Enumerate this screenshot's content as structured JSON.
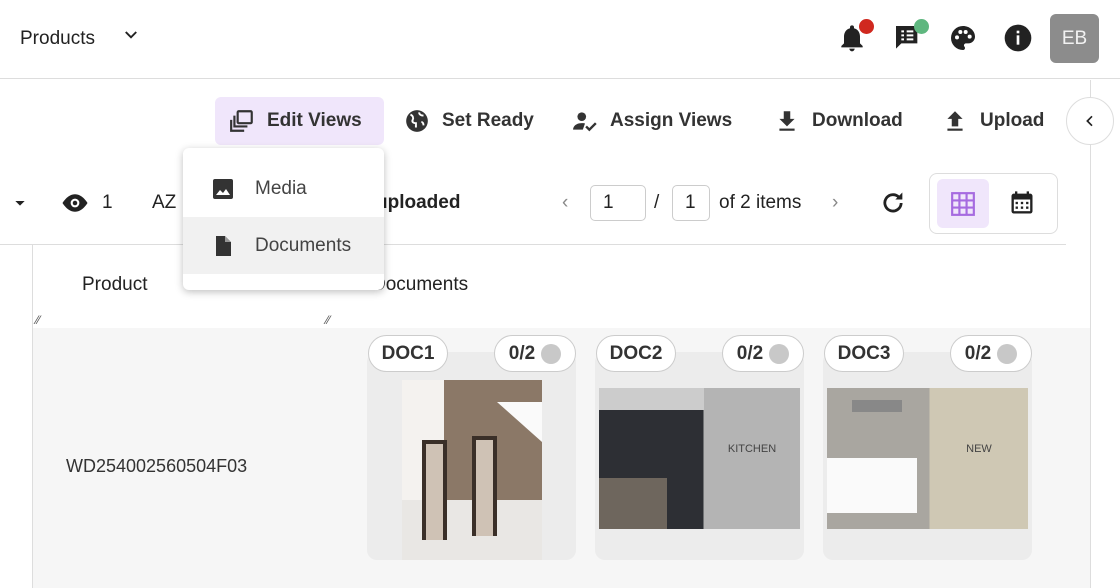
{
  "header": {
    "title": "Products",
    "avatar": "EB",
    "icons": [
      "bell-icon",
      "chat-list-icon",
      "palette-icon",
      "info-icon"
    ],
    "badge_colors": {
      "notifications": "#d0281f",
      "messages": "#5fb77f"
    }
  },
  "toolbar": {
    "edit_views": "Edit Views",
    "set_ready": "Set Ready",
    "assign_views": "Assign Views",
    "download": "Download",
    "upload": "Upload",
    "accent_bg": "#f0e6fb"
  },
  "menu": {
    "items": [
      {
        "label": "Media",
        "icon": "image-icon"
      },
      {
        "label": "Documents",
        "icon": "file-icon"
      }
    ]
  },
  "filters": {
    "visible_count": "1",
    "status_text": "uploaded",
    "page_current": "1",
    "page_total": "1",
    "items_text": "of 2 items",
    "active_view": "grid"
  },
  "table": {
    "headers": [
      "Product",
      "Documents"
    ],
    "rows": [
      {
        "product": "WD254002560504F03",
        "documents": [
          {
            "label": "DOC1",
            "count": "0/2",
            "image_text": ""
          },
          {
            "label": "DOC2",
            "count": "0/2",
            "image_text": "KITCHEN"
          },
          {
            "label": "DOC3",
            "count": "0/2",
            "image_text": "NEW"
          }
        ]
      }
    ]
  }
}
